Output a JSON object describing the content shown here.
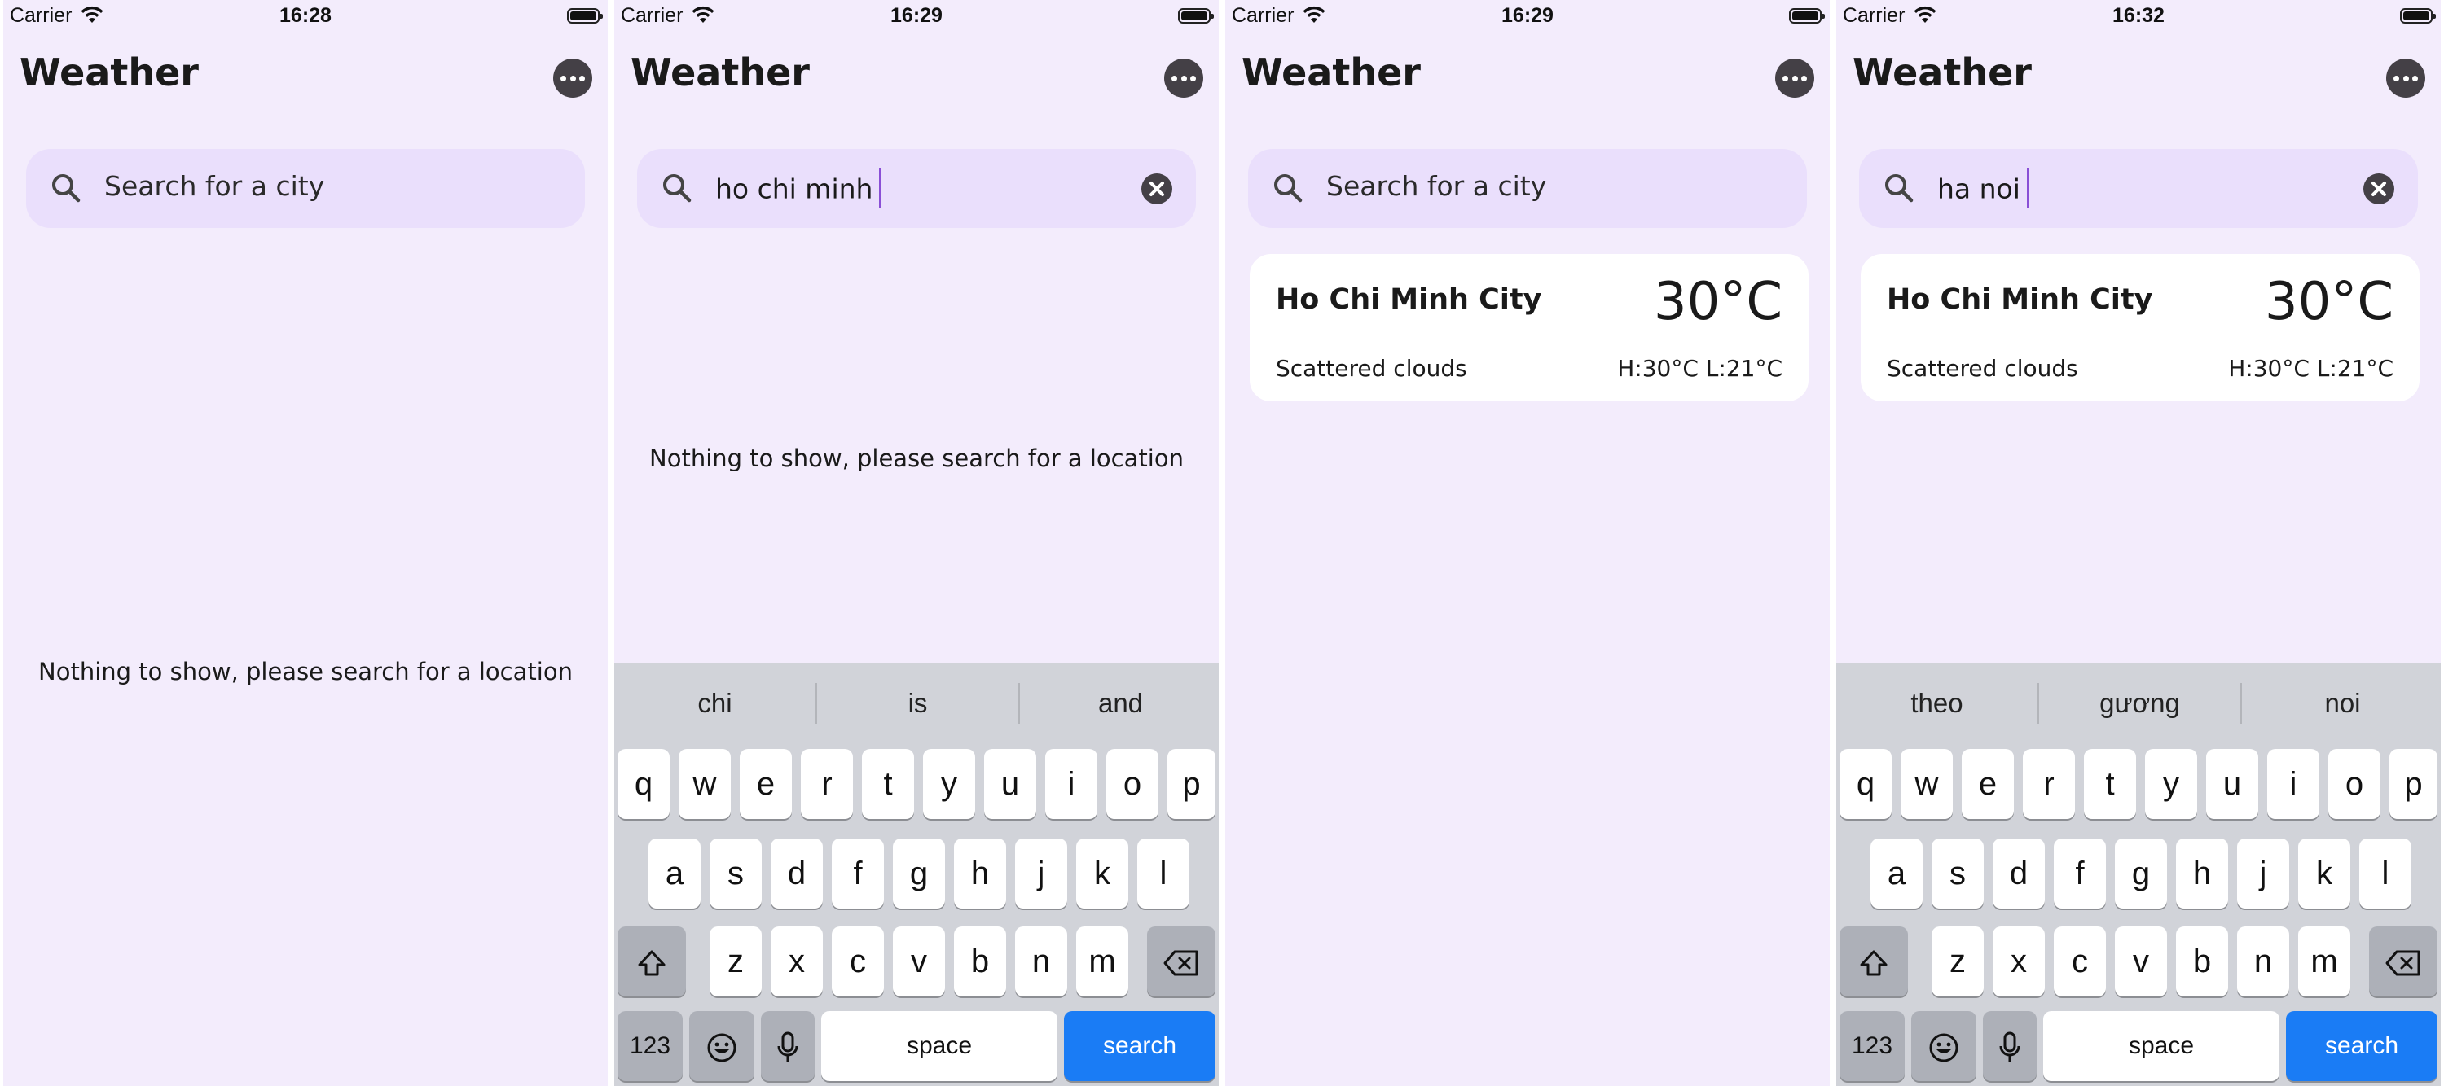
{
  "status_bar": {
    "carrier": "Carrier",
    "times": [
      "16:28",
      "16:29",
      "16:29",
      "16:32"
    ]
  },
  "app": {
    "title": "Weather",
    "more_icon": "ellipsis-circle-icon",
    "accent_color": "#8a4fd6",
    "background_color": "#f3ecfc"
  },
  "screens": [
    {
      "search_value": "",
      "search_placeholder": "Search for a city",
      "empty_message": "Nothing to show, please search for a location"
    },
    {
      "search_value": "ho chi minh",
      "empty_message": "Nothing to show, please search for a location"
    },
    {
      "search_value": "",
      "search_placeholder": "Search for a city"
    },
    {
      "search_value": "ha noi"
    }
  ],
  "weather_card": {
    "city": "Ho Chi Minh City",
    "temperature": "30°C",
    "condition": "Scattered clouds",
    "high_low": "H:30°C L:21°C"
  },
  "keyboard": {
    "suggestions_screen2": [
      "chi",
      "is",
      "and"
    ],
    "suggestions_screen4": [
      "theo",
      "gương",
      "noi"
    ],
    "row1": [
      "q",
      "w",
      "e",
      "r",
      "t",
      "y",
      "u",
      "i",
      "o",
      "p"
    ],
    "row2": [
      "a",
      "s",
      "d",
      "f",
      "g",
      "h",
      "j",
      "k",
      "l"
    ],
    "row3": [
      "z",
      "x",
      "c",
      "v",
      "b",
      "n",
      "m"
    ],
    "numbers_label": "123",
    "space_label": "space",
    "return_label": "search",
    "return_color": "#1a7cf5"
  }
}
